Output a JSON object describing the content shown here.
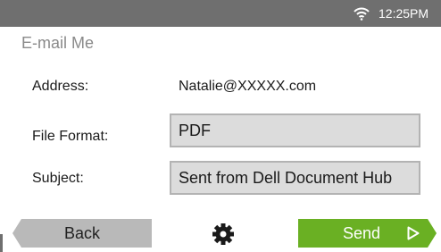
{
  "status": {
    "time": "12:25PM",
    "wifi_icon": "wifi-icon"
  },
  "title": "E-mail Me",
  "address": {
    "label": "Address:",
    "value": "Natalie@XXXXX.com"
  },
  "file_format": {
    "label": "File Format:",
    "value": "PDF"
  },
  "subject": {
    "label": "Subject:",
    "value": "Sent from Dell Document Hub"
  },
  "buttons": {
    "back": "Back",
    "send": "Send",
    "settings_icon": "gear-icon",
    "send_icon": "play-outline-icon"
  },
  "colors": {
    "status_bar": "#6f6f6f",
    "send": "#6ab023",
    "back": "#b9b9b9",
    "field_bg": "#dcdcdc",
    "field_border": "#b3b3b3"
  }
}
